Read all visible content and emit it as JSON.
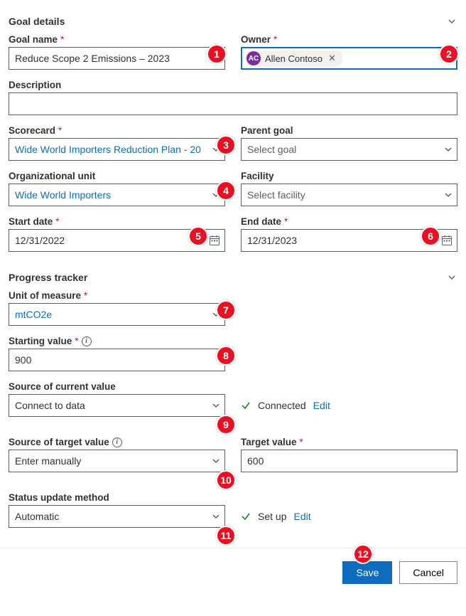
{
  "sections": {
    "goal_details": "Goal details",
    "progress_tracker": "Progress tracker"
  },
  "labels": {
    "goal_name": "Goal name",
    "owner": "Owner",
    "description": "Description",
    "scorecard": "Scorecard",
    "parent_goal": "Parent goal",
    "org_unit": "Organizational unit",
    "facility": "Facility",
    "start_date": "Start date",
    "end_date": "End date",
    "unit_of_measure": "Unit of measure",
    "starting_value": "Starting value",
    "source_current": "Source of current value",
    "source_target": "Source of target value",
    "target_value": "Target value",
    "status_method": "Status update method"
  },
  "values": {
    "goal_name": "Reduce Scope 2 Emissions – 2023",
    "owner_initials": "AC",
    "owner_name": "Allen Contoso",
    "description": "",
    "scorecard": "Wide World Importers Reduction Plan - 20",
    "parent_goal": "Select goal",
    "org_unit": "Wide World Importers",
    "facility": "Select facility",
    "start_date": "12/31/2022",
    "end_date": "12/31/2023",
    "unit_of_measure": "mtCO2e",
    "starting_value": "900",
    "source_current": "Connect to data",
    "source_current_status": "Connected",
    "source_target": "Enter manually",
    "target_value": "600",
    "status_method": "Automatic",
    "status_method_status": "Set up",
    "edit": "Edit"
  },
  "buttons": {
    "save": "Save",
    "cancel": "Cancel"
  },
  "callouts": {
    "b1": "1",
    "b2": "2",
    "b3": "3",
    "b4": "4",
    "b5": "5",
    "b6": "6",
    "b7": "7",
    "b8": "8",
    "b9": "9",
    "b10": "10",
    "b11": "11",
    "b12": "12"
  }
}
